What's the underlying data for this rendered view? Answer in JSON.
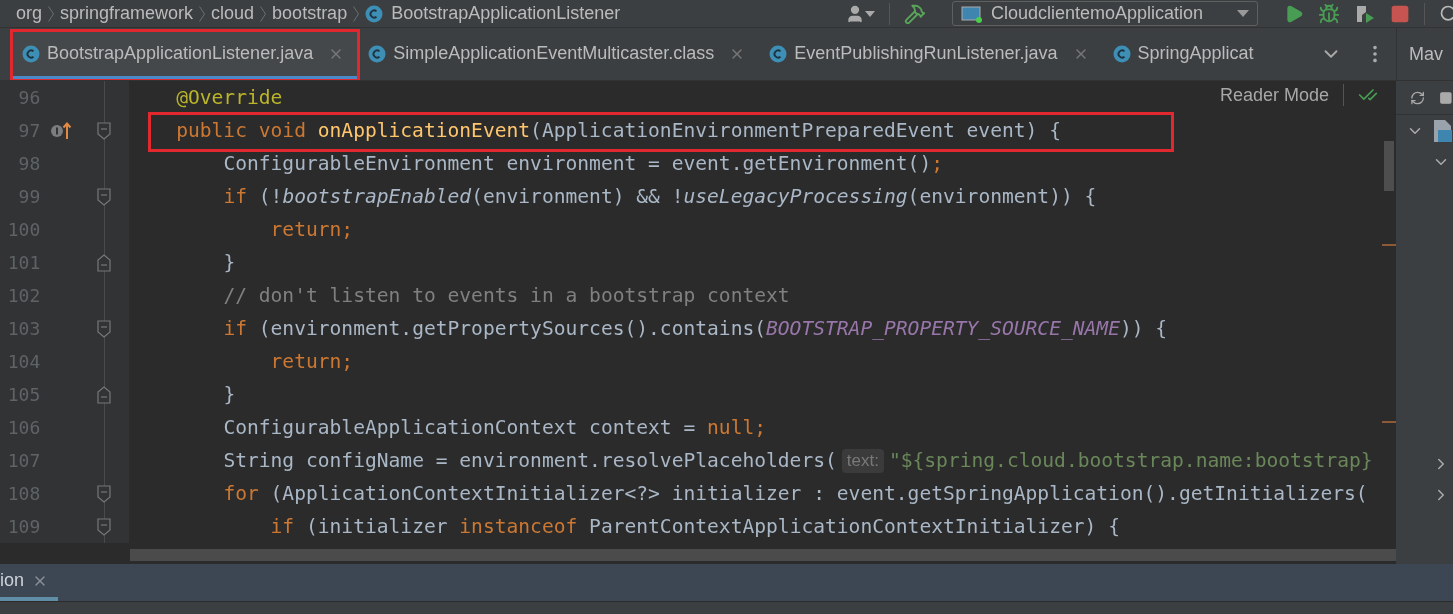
{
  "breadcrumbs": [
    {
      "label": "org",
      "kind": "package"
    },
    {
      "label": "springframework",
      "kind": "package"
    },
    {
      "label": "cloud",
      "kind": "package"
    },
    {
      "label": "bootstrap",
      "kind": "package"
    },
    {
      "label": "BootstrapApplicationListener",
      "kind": "class"
    }
  ],
  "toolbar": {
    "run_configuration": "CloudclientemoApplication"
  },
  "tabs": [
    {
      "label": "BootstrapApplicationListener.java",
      "selected": true,
      "closable": true,
      "boxed": true
    },
    {
      "label": "SimpleApplicationEventMulticaster.class",
      "selected": false,
      "closable": true,
      "boxed": false
    },
    {
      "label": "EventPublishingRunListener.java",
      "selected": false,
      "closable": true,
      "boxed": false
    },
    {
      "label": "SpringApplicat",
      "selected": false,
      "closable": false,
      "boxed": false
    }
  ],
  "side_panel": {
    "title": "Mav"
  },
  "editor": {
    "reader_mode": "Reader Mode",
    "lines": [
      {
        "number": "96",
        "boxed": false,
        "implements": false,
        "fold_open": false,
        "fold_close": false,
        "tokens": [
          {
            "kind": "annotation",
            "text": "    @Override"
          }
        ]
      },
      {
        "number": "97",
        "boxed": true,
        "implements": true,
        "fold_open": true,
        "fold_close": false,
        "tokens": [
          {
            "kind": "keyword",
            "text": "    public void "
          },
          {
            "kind": "declaration",
            "text": "onApplicationEvent"
          },
          {
            "kind": "plain",
            "text": "(ApplicationEnvironmentPreparedEvent event) {"
          }
        ]
      },
      {
        "number": "98",
        "boxed": false,
        "implements": false,
        "fold_open": false,
        "fold_close": false,
        "tokens": [
          {
            "kind": "plain",
            "text": "        ConfigurableEnvironment environment = event.getEnvironment()"
          },
          {
            "kind": "keyword",
            "text": ";"
          }
        ]
      },
      {
        "number": "99",
        "boxed": false,
        "implements": false,
        "fold_open": true,
        "fold_close": false,
        "tokens": [
          {
            "kind": "keyword",
            "text": "        if "
          },
          {
            "kind": "plain",
            "text": "(!"
          },
          {
            "kind": "static",
            "text": "bootstrapEnabled"
          },
          {
            "kind": "plain",
            "text": "(environment) && !"
          },
          {
            "kind": "static",
            "text": "useLegacyProcessing"
          },
          {
            "kind": "plain",
            "text": "(environment)) {"
          }
        ]
      },
      {
        "number": "100",
        "boxed": false,
        "implements": false,
        "fold_open": false,
        "fold_close": false,
        "tokens": [
          {
            "kind": "keyword",
            "text": "            return;"
          }
        ]
      },
      {
        "number": "101",
        "boxed": false,
        "implements": false,
        "fold_open": false,
        "fold_close": true,
        "tokens": [
          {
            "kind": "plain",
            "text": "        }"
          }
        ]
      },
      {
        "number": "102",
        "boxed": false,
        "implements": false,
        "fold_open": false,
        "fold_close": false,
        "tokens": [
          {
            "kind": "comment",
            "text": "        // don't listen to events in a bootstrap context"
          }
        ]
      },
      {
        "number": "103",
        "boxed": false,
        "implements": false,
        "fold_open": true,
        "fold_close": false,
        "tokens": [
          {
            "kind": "keyword",
            "text": "        if "
          },
          {
            "kind": "plain",
            "text": "(environment.getPropertySources().contains("
          },
          {
            "kind": "constant",
            "text": "BOOTSTRAP_PROPERTY_SOURCE_NAME"
          },
          {
            "kind": "plain",
            "text": ")) {"
          }
        ]
      },
      {
        "number": "104",
        "boxed": false,
        "implements": false,
        "fold_open": false,
        "fold_close": false,
        "tokens": [
          {
            "kind": "keyword",
            "text": "            return;"
          }
        ]
      },
      {
        "number": "105",
        "boxed": false,
        "implements": false,
        "fold_open": false,
        "fold_close": true,
        "tokens": [
          {
            "kind": "plain",
            "text": "        }"
          }
        ]
      },
      {
        "number": "106",
        "boxed": false,
        "implements": false,
        "fold_open": false,
        "fold_close": false,
        "tokens": [
          {
            "kind": "plain",
            "text": "        ConfigurableApplicationContext context = "
          },
          {
            "kind": "keyword",
            "text": "null;"
          }
        ]
      },
      {
        "number": "107",
        "boxed": false,
        "implements": false,
        "fold_open": false,
        "fold_close": false,
        "tokens": [
          {
            "kind": "plain",
            "text": "        String configName = environment.resolvePlaceholders("
          },
          {
            "kind": "hint",
            "text": "text:"
          },
          {
            "kind": "string",
            "text": "\"${spring.cloud.bootstrap.name:bootstrap}"
          }
        ]
      },
      {
        "number": "108",
        "boxed": false,
        "implements": false,
        "fold_open": true,
        "fold_close": false,
        "tokens": [
          {
            "kind": "keyword",
            "text": "        for "
          },
          {
            "kind": "plain",
            "text": "(ApplicationContextInitializer<?> initializer : event.getSpringApplication().getInitializers("
          }
        ]
      },
      {
        "number": "109",
        "boxed": false,
        "implements": false,
        "fold_open": true,
        "fold_close": false,
        "tokens": [
          {
            "kind": "keyword",
            "text": "            if "
          },
          {
            "kind": "plain",
            "text": "(initializer "
          },
          {
            "kind": "keyword",
            "text": "instanceof "
          },
          {
            "kind": "plain",
            "text": "ParentContextApplicationContextInitializer) {"
          }
        ]
      }
    ]
  },
  "bottom_panel": {
    "tabs": [
      {
        "label": "ion",
        "selected": true
      }
    ]
  }
}
